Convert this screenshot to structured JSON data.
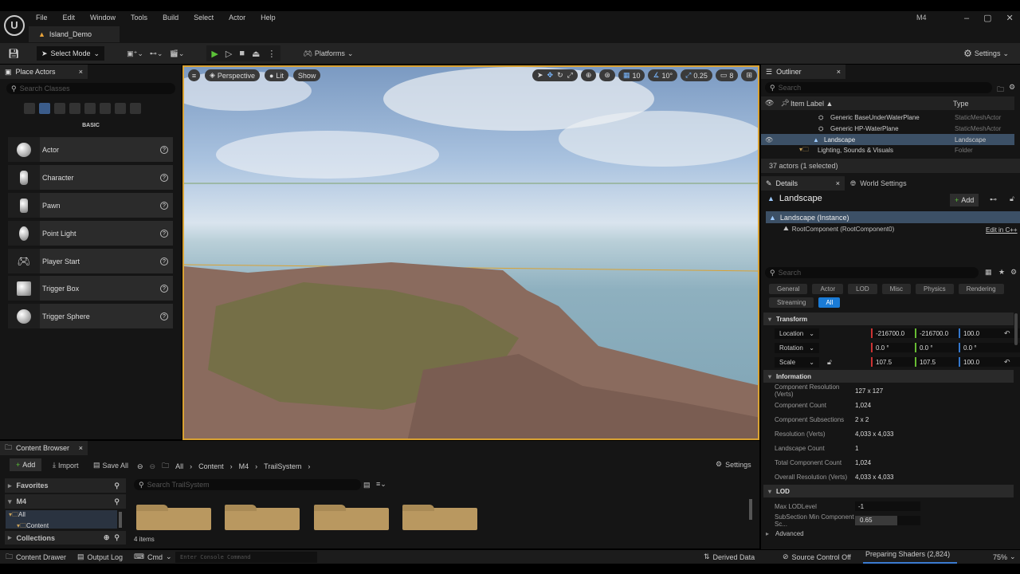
{
  "menu": [
    "File",
    "Edit",
    "Window",
    "Tools",
    "Build",
    "Select",
    "Actor",
    "Help"
  ],
  "project_tab": "Island_Demo",
  "project_name": "M4",
  "toolbar": {
    "select_mode": "Select Mode",
    "platforms": "Platforms",
    "settings": "Settings"
  },
  "place_actors": {
    "title": "Place Actors",
    "search_placeholder": "Search Classes",
    "category": "BASIC",
    "items": [
      "Actor",
      "Character",
      "Pawn",
      "Point Light",
      "Player Start",
      "Trigger Box",
      "Trigger Sphere"
    ]
  },
  "viewport": {
    "perspective": "Perspective",
    "lit": "Lit",
    "show": "Show",
    "grid_snap": "10",
    "rot_snap": "10°",
    "scale_snap": "0.25",
    "camera_speed": "8"
  },
  "outliner": {
    "title": "Outliner",
    "search_placeholder": "Search",
    "col_label": "Item Label ▲",
    "col_type": "Type",
    "rows": [
      {
        "label": "Generic BaseUnderWaterPlane",
        "type": "StaticMeshActor"
      },
      {
        "label": "Generic HP-WaterPlane",
        "type": "StaticMeshActor"
      },
      {
        "label": "Landscape",
        "type": "Landscape"
      },
      {
        "label": "Lighting, Sounds & Visuals",
        "type": "Folder"
      }
    ],
    "status": "37 actors (1 selected)"
  },
  "details": {
    "tab": "Details",
    "world_tab": "World Settings",
    "title": "Landscape",
    "add": "Add",
    "instance": "Landscape (Instance)",
    "root": "RootComponent (RootComponent0)",
    "edit_cpp": "Edit in C++",
    "search_placeholder": "Search",
    "filters": [
      "General",
      "Actor",
      "LOD",
      "Misc",
      "Physics",
      "Rendering",
      "Streaming",
      "All"
    ],
    "transform_label": "Transform",
    "transform": [
      {
        "label": "Location",
        "x": "-216700.0",
        "y": "-216700.0",
        "z": "100.0"
      },
      {
        "label": "Rotation",
        "x": "0.0 °",
        "y": "0.0 °",
        "z": "0.0 °"
      },
      {
        "label": "Scale",
        "x": "107.5",
        "y": "107.5",
        "z": "100.0"
      }
    ],
    "information_label": "Information",
    "information": [
      {
        "k": "Component Resolution (Verts)",
        "v": "127 x 127"
      },
      {
        "k": "Component Count",
        "v": "1,024"
      },
      {
        "k": "Component Subsections",
        "v": "2 x 2"
      },
      {
        "k": "Resolution (Verts)",
        "v": "4,033 x 4,033"
      },
      {
        "k": "Landscape Count",
        "v": "1"
      },
      {
        "k": "Total Component Count",
        "v": "1,024"
      },
      {
        "k": "Overall Resolution (Verts)",
        "v": "4,033 x 4,033"
      }
    ],
    "lod_label": "LOD",
    "max_lod_label": "Max LODLevel",
    "max_lod": "-1",
    "subsection_label": "SubSection Min Component Sc...",
    "subsection": "0.65",
    "subsection_fraction": 0.65,
    "advanced": "Advanced"
  },
  "content_browser": {
    "title": "Content Browser",
    "add": "Add",
    "import": "Import",
    "save_all": "Save All",
    "breadcrumb": [
      "All",
      "Content",
      "M4",
      "TrailSystem"
    ],
    "settings": "Settings",
    "favorites": "Favorites",
    "m4": "M4",
    "tree": [
      "All",
      "Content"
    ],
    "collections": "Collections",
    "search_placeholder": "Search TrailSystem",
    "count": "4 items"
  },
  "statusbar": {
    "content_drawer": "Content Drawer",
    "output_log": "Output Log",
    "cmd": "Cmd",
    "console_placeholder": "Enter Console Command",
    "derived": "Derived Data",
    "source_control": "Source Control Off",
    "shaders": "Preparing Shaders (2,824)",
    "zoom": "75%"
  }
}
